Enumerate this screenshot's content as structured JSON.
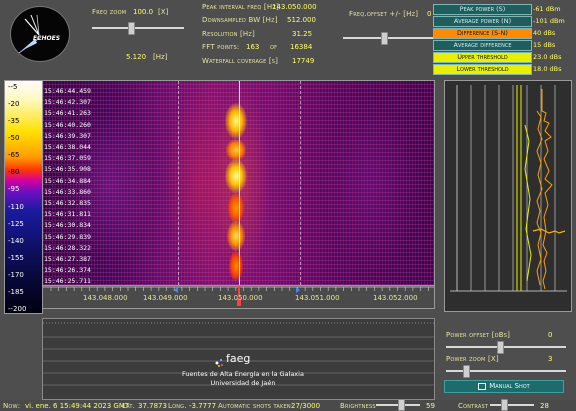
{
  "header": {
    "freq_zoom_label": "Freq zoom",
    "freq_zoom_value": "100.0",
    "freq_zoom_unit": "[X]",
    "freq_zoom_hz_value": "5.120",
    "freq_zoom_hz_unit": "[Hz]",
    "peak_interval_label": "Peak interval freq [Hz]",
    "peak_interval_value": "143.050.000",
    "downsampled_label": "Downsampled BW [Hz]",
    "downsampled_value": "512.000",
    "resolution_label": "Resolution [Hz]",
    "resolution_value": "31.25",
    "fft_label": "FFT points:",
    "fft_value": "163",
    "fft_of": "of",
    "fft_total": "16384",
    "waterfall_label": "Waterfall coverage [s]",
    "waterfall_value": "17749",
    "freq_offset_label": "Freq.offset +/- [Hz]",
    "freq_offset_value": "0",
    "freq_offset_level": 0.45,
    "freq_zoom_level": 0.42
  },
  "legend": {
    "items": [
      {
        "label": "Peak power (S)",
        "value": "-61 dBm",
        "bg": "#1f5e5e",
        "fg": "#cfeff0"
      },
      {
        "label": "Average power (N)",
        "value": "-101 dBm",
        "bg": "#1f5e5e",
        "fg": "#cfeff0"
      },
      {
        "label": "Difference (S-N)",
        "value": "40 dBs",
        "bg": "#ff8c00",
        "fg": "#111111"
      },
      {
        "label": "Average difference",
        "value": "15 dBs",
        "bg": "#1f5e5e",
        "fg": "#cfeff0"
      },
      {
        "label": "Upper threshold",
        "value": "23.0 dBs",
        "bg": "#e8f000",
        "fg": "#111111"
      },
      {
        "label": "Lower threshold",
        "value": "18.0 dBs",
        "bg": "#e8f000",
        "fg": "#111111"
      }
    ]
  },
  "colorbar": {
    "labels": [
      "--5",
      "-20",
      "-35",
      "-50",
      "-65",
      "-80",
      "-95",
      "-110",
      "-125",
      "-140",
      "-155",
      "-170",
      "-185",
      "--200"
    ]
  },
  "waterfall": {
    "timestamps": [
      "15:46:44.459",
      "15:46:42.307",
      "15:46:41.263",
      "15:46:40.260",
      "15:46:39.307",
      "15:46:38.044",
      "15:46:37.059",
      "15:46:35.908",
      "15:46:34.884",
      "15:46:33.860",
      "15:46:32.835",
      "15:46:31.811",
      "15:46:30.834",
      "15:46:29.839",
      "15:46:28.322",
      "15:46:27.387",
      "15:46:26.374",
      "15:46:25.711"
    ]
  },
  "freq_axis": {
    "labels": [
      "143.048.000",
      "143.049.000",
      "143.050.000",
      "143.051.000",
      "143.052.000"
    ]
  },
  "lower_panel": {
    "logo_text": "faeg",
    "org_line1": "Fuentes de Alta Energía en la Galaxia",
    "org_line2": "Universidad de Jaén"
  },
  "controls": {
    "power_offset_label": "Power offset [dBs]",
    "power_offset_value": "0",
    "power_offset_level": 0.45,
    "power_zoom_label": "Power zoom [X]",
    "power_zoom_value": "3",
    "power_zoom_level": 0.15,
    "manual_shot_label": "Manual Shot"
  },
  "status": {
    "now_label": "Now:",
    "now_value": "vi. ene. 6 15:49:44 2023 GMT",
    "lat_label": "Lat.",
    "lat_value": "37.7873",
    "long_label": "Long.",
    "long_value": "-3.7777",
    "shots_label": "Automatic shots taken:",
    "shots_value": "27/3000",
    "brightness_label": "Brightness",
    "brightness_value": "59",
    "brightness_level": 0.59,
    "contrast_label": "Contrast",
    "contrast_value": "28",
    "contrast_level": 0.28
  },
  "logo": {
    "text": "ECHOES"
  }
}
